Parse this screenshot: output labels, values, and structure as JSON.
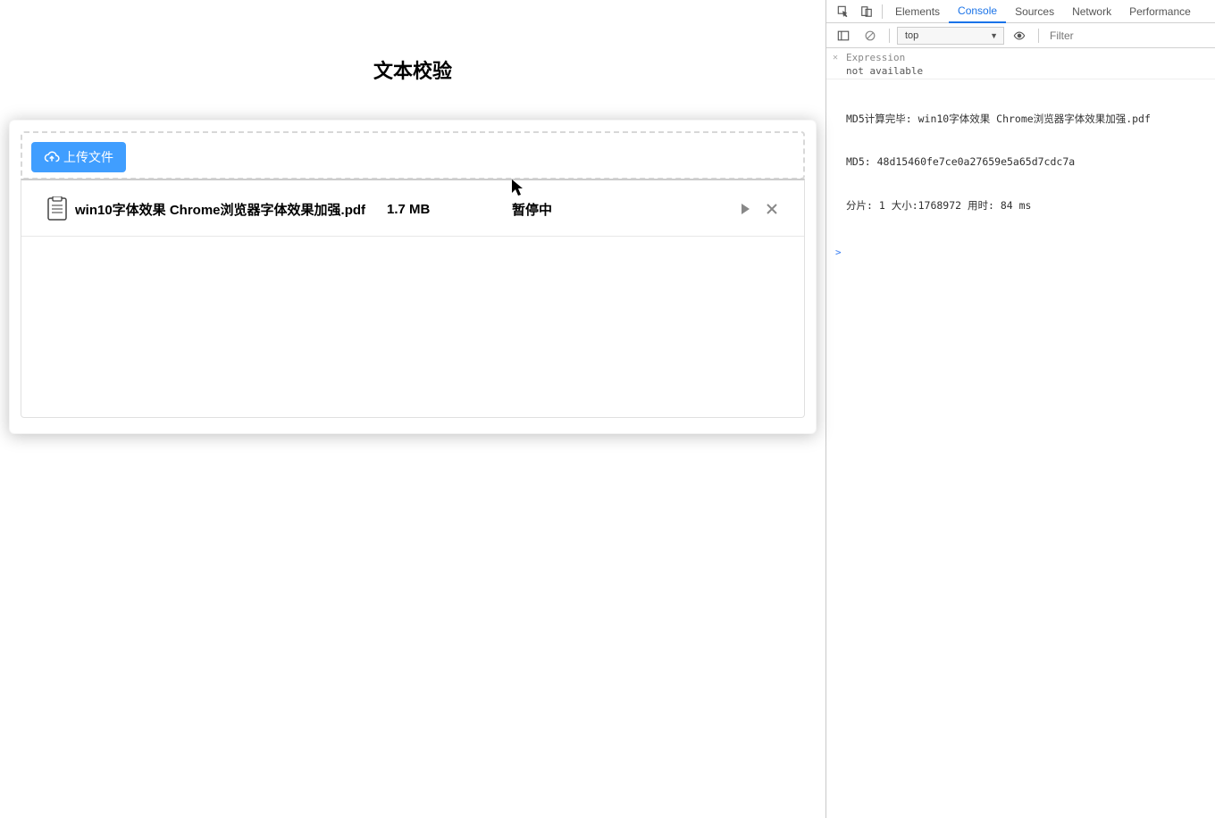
{
  "page": {
    "title": "文本校验",
    "uploadButton": "上传文件"
  },
  "file": {
    "name": "win10字体效果 Chrome浏览器字体效果加强.pdf",
    "size": "1.7 MB",
    "status": "暂停中"
  },
  "devtools": {
    "tabs": {
      "elements": "Elements",
      "console": "Console",
      "sources": "Sources",
      "network": "Network",
      "performance": "Performance"
    },
    "context": "top",
    "filterPlaceholder": "Filter",
    "expression": {
      "label": "Expression",
      "value": "not available"
    },
    "log": {
      "l1": "MD5计算完毕: win10字体效果 Chrome浏览器字体效果加强.pdf",
      "l2": "MD5: 48d15460fe7ce0a27659e5a65d7cdc7a",
      "l3": "分片: 1 大小:1768972 用时: 84 ms"
    },
    "prompt": ">"
  }
}
